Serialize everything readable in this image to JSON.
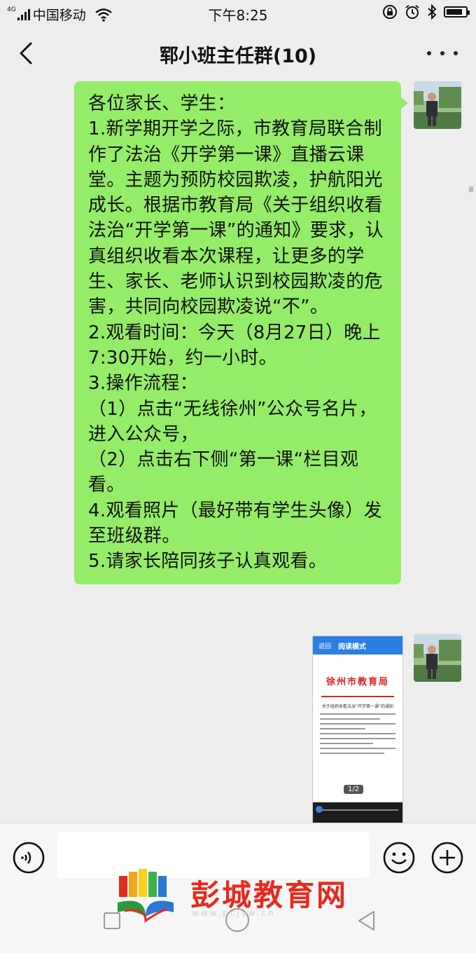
{
  "status_bar": {
    "network_badge": "4G",
    "carrier": "中国移动",
    "time": "下午8:25",
    "battery_level": 0.85
  },
  "header": {
    "title": "郓小班主任群(10)"
  },
  "messages": [
    {
      "type": "text",
      "sender": "self",
      "text": "各位家长、学生：\n1.新学期开学之际，市教育局联合制作了法治《开学第一课》直播云课堂。主题为预防校园欺凌，护航阳光成长。根据市教育局《关于组织收看法治“开学第一课”的通知》要求，认真组织收看本次课程，让更多的学生、家长、老师认识到校园欺凌的危害，共同向校园欺凌说“不”。\n2.观看时间：今天（8月27日）晚上7:30开始，约一小时。\n3.操作流程：\n（1）点击“无线徐州”公众号名片，进入公众号，\n（2）点击右下侧“第一课“栏目观看。\n4.观看照片（最好带有学生头像）发至班级群。\n5.请家长陪同孩子认真观看。"
    },
    {
      "type": "image",
      "sender": "self",
      "image": {
        "header_left": "返回",
        "header_title": "阅读模式",
        "doc_org": "徐州市教育局",
        "doc_subtitle": "关于组织收看法治“开学第一课”的通知",
        "page_indicator": "1/2"
      }
    }
  ],
  "input": {
    "placeholder": ""
  },
  "watermark": {
    "text": "彭城教育网",
    "url": "www.pcjyw.cn"
  },
  "colors": {
    "bubble": "#95ec69",
    "watermark": "#e52a1e",
    "doc_header": "#2b7fe0"
  }
}
